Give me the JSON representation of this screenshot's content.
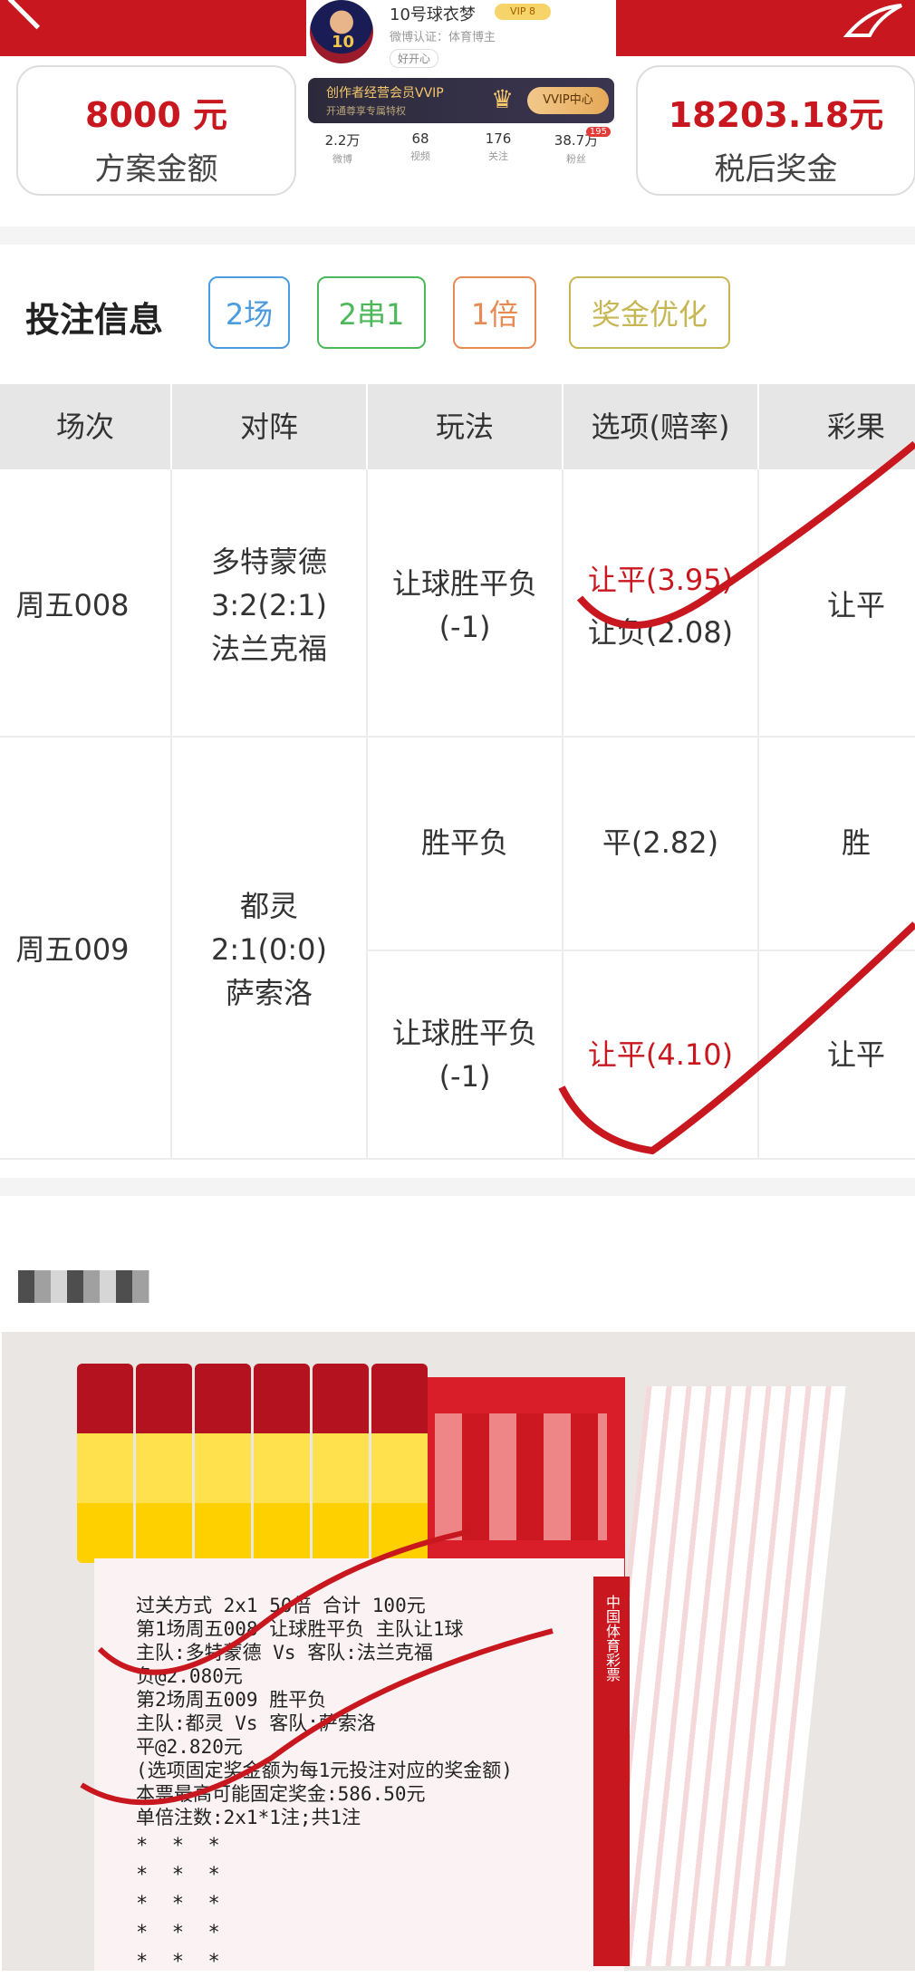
{
  "profile": {
    "name": "10号球衣梦",
    "vip": "VIP 8",
    "cert": "微博认证：体育博主",
    "follow": "好开心",
    "avatar_number": "10",
    "banner_title": "创作者经营会员VVIP",
    "banner_sub": "开通尊享专属特权",
    "vip_center": "VVIP中心",
    "stats": [
      {
        "n": "2.2万",
        "l": "微博"
      },
      {
        "n": "68",
        "l": "视频"
      },
      {
        "n": "176",
        "l": "关注"
      },
      {
        "n": "38.7万",
        "l": "粉丝"
      }
    ],
    "fans_badge": "195"
  },
  "summary": {
    "amount_value": "8000 元",
    "amount_label": "方案金额",
    "prize_value": "18203.18元",
    "prize_label": "税后奖金"
  },
  "bet": {
    "title": "投注信息",
    "tags": [
      "2场",
      "2串1",
      "1倍",
      "奖金优化"
    ]
  },
  "table": {
    "headers": [
      "场次",
      "对阵",
      "玩法",
      "选项(赔率)",
      "彩果"
    ],
    "rows": [
      {
        "match_no": "周五008",
        "home": "多特蒙德",
        "score": "3:2(2:1)",
        "away": "法兰克福",
        "play1": "让球胜平负",
        "play1b": "(-1)",
        "opt1a": "让平(3.95)",
        "opt1b": "让负(2.08)",
        "result1": "让平"
      },
      {
        "match_no": "周五009",
        "home": "都灵",
        "score": "2:1(0:0)",
        "away": "萨索洛",
        "play1": "胜平负",
        "opt1": "平(2.82)",
        "result1": "胜",
        "play2": "让球胜平负",
        "play2b": "(-1)",
        "opt2": "让平(4.10)",
        "result2": "让平"
      }
    ]
  },
  "ticket": {
    "brand": "中国体育彩票",
    "lines": [
      "过关方式 2x1      50倍       合计 100元",
      "第1场周五008 让球胜平负   主队让1球",
      "主队:多特蒙德 Vs 客队:法兰克福",
      "负@2.080元",
      "第2场周五009 胜平负",
      "主队:都灵 Vs 客队:萨索洛",
      "平@2.820元",
      "(选项固定奖金额为每1元投注对应的奖金额)",
      "本票最高可能固定奖金:586.50元",
      "单倍注数:2x1*1注;共1注"
    ],
    "stars": "*  *  *\n*  *  *\n*  *  *\n*  *  *\n*  *  *"
  },
  "colors": {
    "brand_red": "#c8171e",
    "tag_blue": "#4a9be0",
    "tag_green": "#4cb859",
    "tag_orange": "#e88a54",
    "tag_yellow": "#c7b754"
  }
}
